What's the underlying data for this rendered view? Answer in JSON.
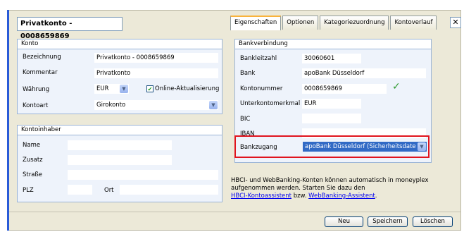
{
  "window": {
    "title": "Privatkonto - 0008659869",
    "close_glyph": "✕"
  },
  "tabs": [
    {
      "label": "Eigenschaften",
      "active": true
    },
    {
      "label": "Optionen"
    },
    {
      "label": "Kategoriezuordnung"
    },
    {
      "label": "Kontoverlauf"
    }
  ],
  "konto": {
    "header": "Konto",
    "bezeichnung_label": "Bezeichnung",
    "bezeichnung_value": "Privatkonto - 0008659869",
    "kommentar_label": "Kommentar",
    "kommentar_value": "Privatkonto",
    "waehrung_label": "Währung",
    "waehrung_value": "EUR",
    "online_label": "Online-Aktualisierung",
    "online_checked": true,
    "kontoart_label": "Kontoart",
    "kontoart_value": "Girokonto"
  },
  "inhaber": {
    "header": "Kontoinhaber",
    "name_label": "Name",
    "zusatz_label": "Zusatz",
    "strasse_label": "Straße",
    "plz_label": "PLZ",
    "ort_label": "Ort"
  },
  "bank": {
    "header": "Bankverbindung",
    "blz_label": "Bankleitzahl",
    "blz_value": "30060601",
    "bank_label": "Bank",
    "bank_value": "apoBank Düsseldorf",
    "kontonummer_label": "Kontonummer",
    "kontonummer_value": "0008659869",
    "unterkonto_label": "Unterkontomerkmal",
    "unterkonto_value": "EUR",
    "bic_label": "BIC",
    "iban_label": "IBAN",
    "bankzugang_label": "Bankzugang",
    "bankzugang_value": "apoBank Düsseldorf (Sicherheitsdate"
  },
  "info": {
    "text": "HBCI- und WebBanking-Konten können automatisch in moneyplex aufgenommen werden. Starten Sie dazu den",
    "link1": "HBCI-Kontoassistent",
    "between": " bzw. ",
    "link2": "WebBanking-Assistent",
    "end": "."
  },
  "buttons": {
    "neu": "Neu",
    "speichern": "Speichern",
    "loeschen": "Löschen"
  },
  "colors": {
    "accent": "#2a5bd7",
    "highlight": "#e0141e",
    "selection": "#316ac5",
    "check": "#2e9a2e"
  }
}
